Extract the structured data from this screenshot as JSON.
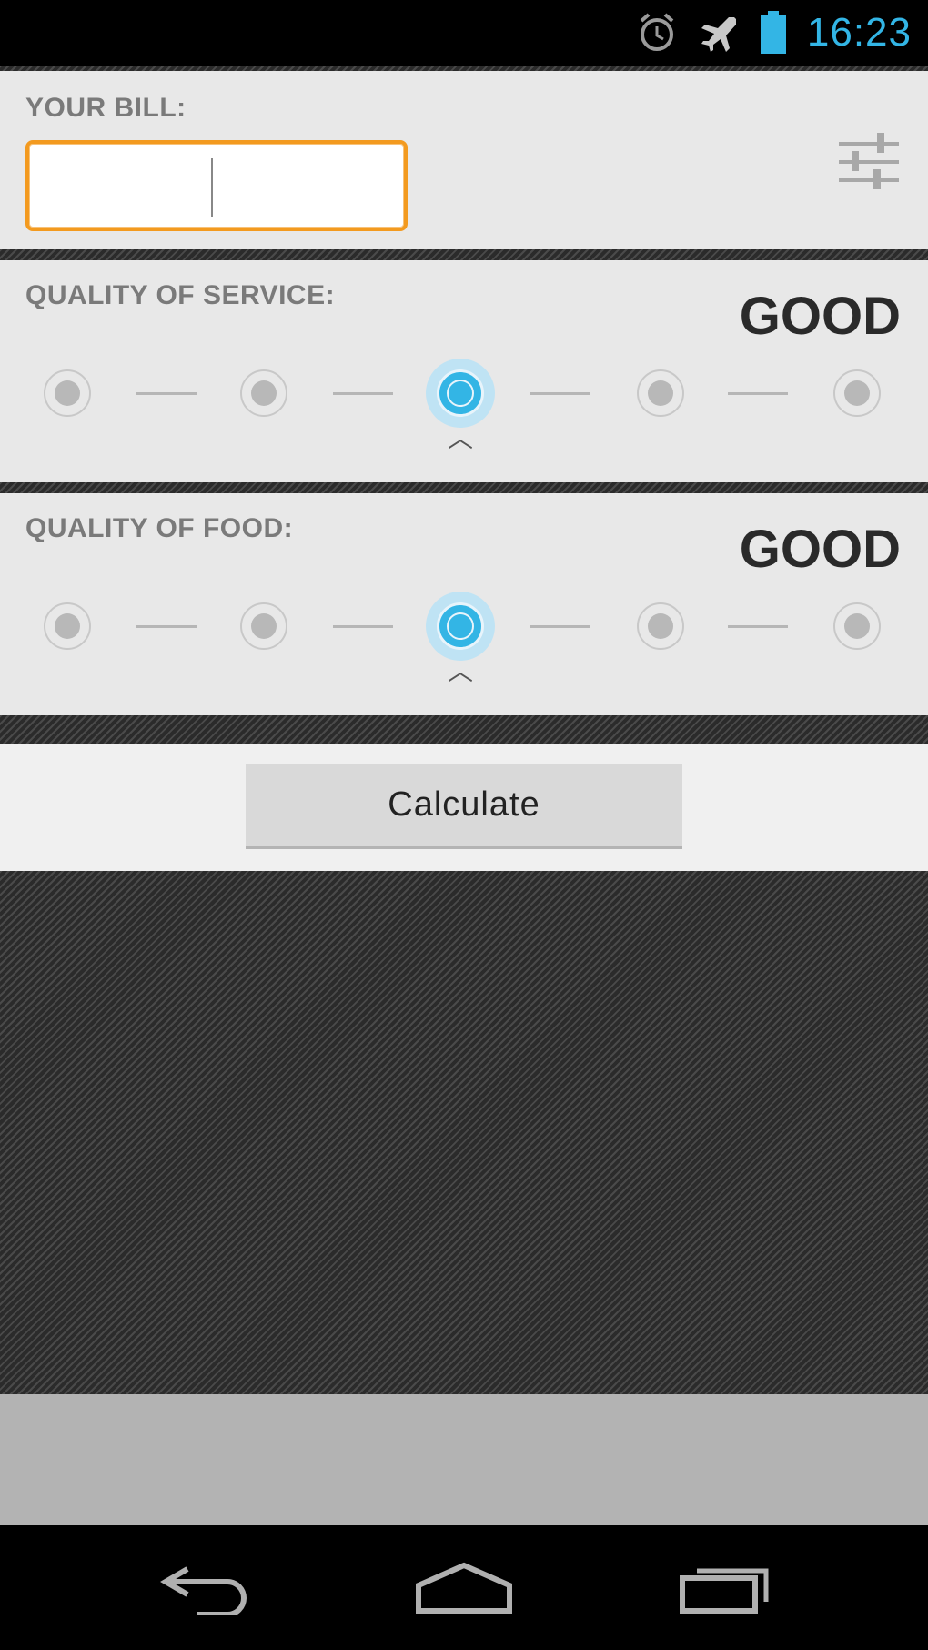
{
  "status_bar": {
    "time": "16:23",
    "icons": [
      "alarm-icon",
      "airplane-mode-icon",
      "battery-icon"
    ],
    "accent_color": "#33b5e5"
  },
  "bill": {
    "label": "YOUR BILL:",
    "input_value": "",
    "input_border_color": "#f39a1f",
    "settings_icon": "sliders-settings-icon"
  },
  "service": {
    "label": "QUALITY OF SERVICE:",
    "value": "GOOD",
    "rating": 3,
    "max": 5
  },
  "food": {
    "label": "QUALITY OF FOOD:",
    "value": "GOOD",
    "rating": 3,
    "max": 5
  },
  "calculate_button": {
    "label": "Calculate"
  },
  "nav_bar": {
    "icons": [
      "back-icon",
      "home-icon",
      "recent-apps-icon"
    ]
  }
}
